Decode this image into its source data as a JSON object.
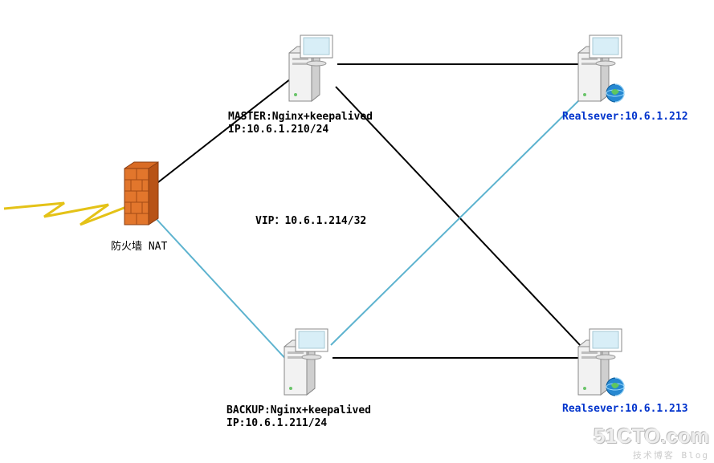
{
  "nodes": {
    "firewall": {
      "label": "防火墙 NAT"
    },
    "master": {
      "line1": "MASTER:Nginx+keepalived",
      "line2": "IP:10.6.1.210/24"
    },
    "backup": {
      "line1": "BACKUP:Nginx+keepalived",
      "line2": "IP:10.6.1.211/24"
    },
    "rs1": {
      "label": "Realsever:10.6.1.212"
    },
    "rs2": {
      "label": "Realsever:10.6.1.213"
    }
  },
  "vip": {
    "label": "VIP：10.6.1.214/32"
  },
  "watermark": {
    "brand": "51CTO.com",
    "sub": "技术博客  Blog"
  },
  "colors": {
    "primaryLink": "#000000",
    "backupLink": "#5db3cf",
    "serverBody": "#e6e6e6",
    "serverShadow": "#c0c0c0",
    "firewallBrick": "#e2762c",
    "globe": "#2688d1"
  }
}
